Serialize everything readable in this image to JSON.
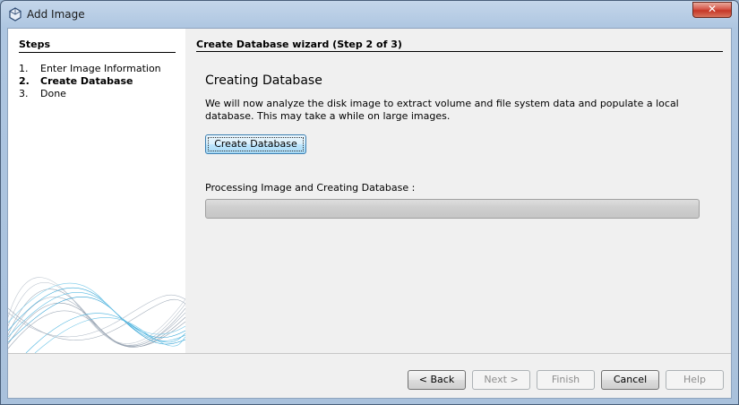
{
  "window": {
    "title": "Add Image",
    "close_label": "✕"
  },
  "steps": {
    "heading": "Steps",
    "items": [
      {
        "number": "1.",
        "label": "Enter Image Information"
      },
      {
        "number": "2.",
        "label": "Create Database"
      },
      {
        "number": "3.",
        "label": "Done"
      }
    ]
  },
  "wizard": {
    "heading": "Create Database wizard (Step 2 of 3)",
    "section_title": "Creating Database",
    "description": "We will now analyze the disk image to extract volume and file system data and populate a local database. This may take a while on large images.",
    "create_button": "Create Database",
    "progress_label": "Processing Image and Creating Database :",
    "progress_fraction": 0
  },
  "footer": {
    "back": "< Back",
    "next": "Next >",
    "finish": "Finish",
    "cancel": "Cancel",
    "help": "Help"
  },
  "colors": {
    "title_bar": "#aec6e1",
    "close_button": "#c53727",
    "focus_button": "#bee6fd",
    "wave_lines": "#3aa8d8"
  }
}
